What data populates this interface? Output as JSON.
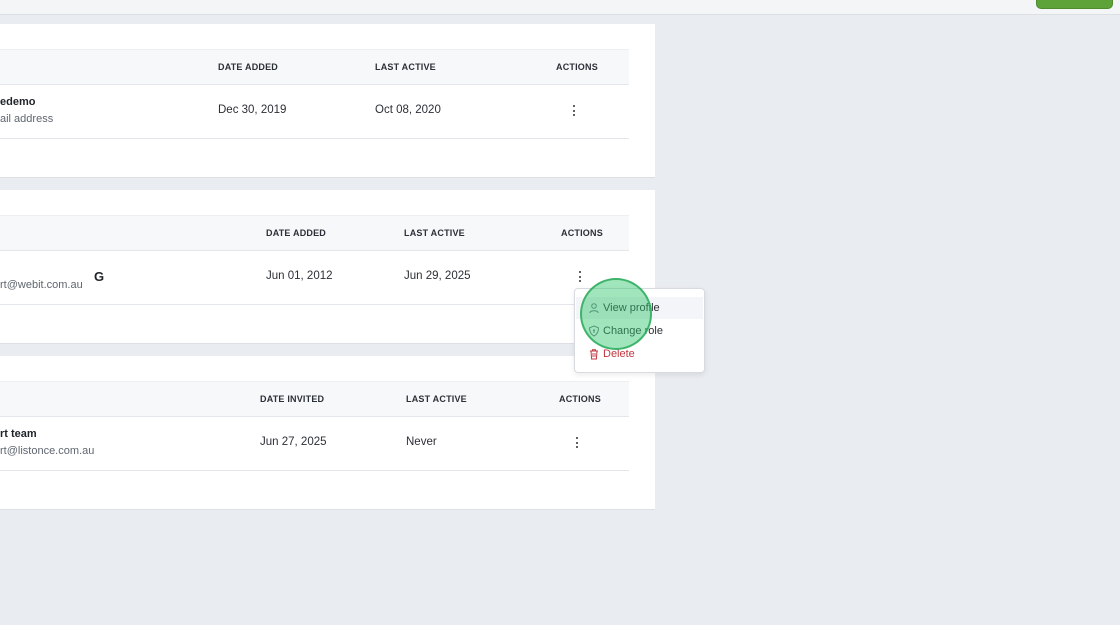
{
  "sections": [
    {
      "columns": [
        "DATE ADDED",
        "LAST ACTIVE",
        "ACTIONS"
      ],
      "row": {
        "name": "edemo",
        "subtext": "ail address",
        "date": "Dec 30, 2019",
        "last_active": "Oct 08, 2020"
      }
    },
    {
      "columns": [
        "DATE ADDED",
        "LAST ACTIVE",
        "ACTIONS"
      ],
      "row": {
        "name": "",
        "subtext": "rt@webit.com.au",
        "provider_icon": "google-icon",
        "provider_glyph": "G",
        "date": "Jun 01, 2012",
        "last_active": "Jun 29, 2025"
      }
    },
    {
      "columns": [
        "DATE INVITED",
        "LAST ACTIVE",
        "ACTIONS"
      ],
      "row": {
        "name": "rt team",
        "subtext": "rt@listonce.com.au",
        "date": "Jun 27, 2025",
        "last_active": "Never"
      }
    }
  ],
  "action_menu": {
    "items": [
      {
        "label": "View profile",
        "icon": "user-icon"
      },
      {
        "label": "Change role",
        "icon": "shield-icon"
      },
      {
        "label": "Delete",
        "icon": "trash-icon",
        "color": "#c0373f"
      }
    ]
  },
  "colors": {
    "accent_green": "#5ea23a",
    "danger": "#c0373f",
    "click_indicator": "#2ec56b"
  }
}
